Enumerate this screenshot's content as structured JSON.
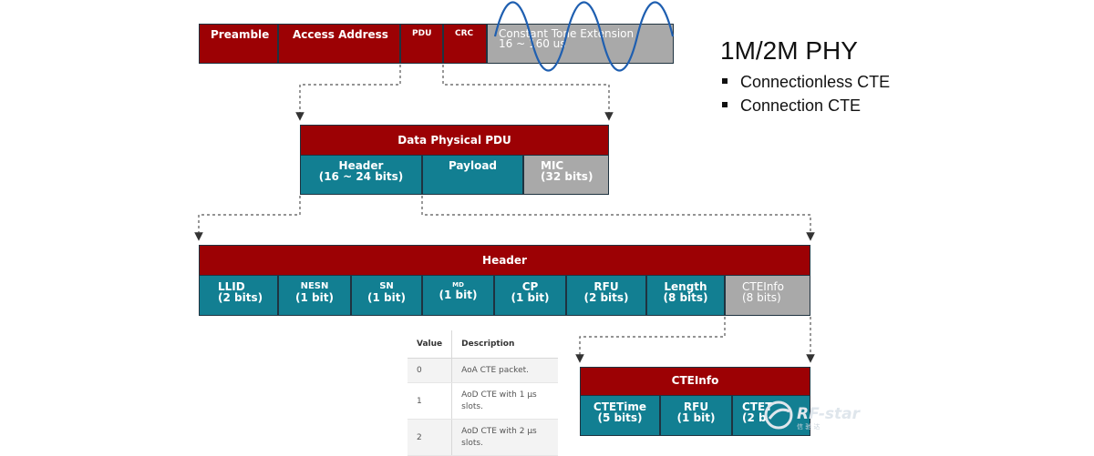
{
  "packet": {
    "fields": [
      "Preamble",
      "Access Address",
      "PDU",
      "CRC"
    ],
    "cte_title": "Constant Tone Extension",
    "cte_range": "16 ~ 160 us"
  },
  "phy": {
    "title": "1M/2M PHY",
    "bullets": [
      "Connectionless CTE",
      "Connection CTE"
    ]
  },
  "data_pdu": {
    "title": "Data Physical PDU",
    "header_line1": "Header",
    "header_line2": "(16 ~ 24 bits)",
    "payload": "Payload",
    "mic_line1": "MIC",
    "mic_line2": "(32 bits)"
  },
  "header": {
    "title": "Header",
    "cells": [
      {
        "name": "LLID",
        "bits": "(2 bits)"
      },
      {
        "name": "NESN",
        "bits": "(1 bit)"
      },
      {
        "name": "SN",
        "bits": "(1 bit)"
      },
      {
        "name": "MD",
        "bits": "(1 bit)"
      },
      {
        "name": "CP",
        "bits": "(1 bit)"
      },
      {
        "name": "RFU",
        "bits": "(2 bits)"
      },
      {
        "name": "Length",
        "bits": "(8 bits)"
      },
      {
        "name": "CTEInfo",
        "bits": "(8 bits)"
      }
    ]
  },
  "cte_table": {
    "headers": [
      "Value",
      "Description"
    ],
    "rows": [
      {
        "value": "0",
        "desc": "AoA CTE packet."
      },
      {
        "value": "1",
        "desc_line1": "AoD CTE with 1 µs",
        "desc_line2": "slots."
      },
      {
        "value": "2",
        "desc_line1": "AoD CTE with 2 µs",
        "desc_line2": "slots."
      }
    ]
  },
  "cteinfo": {
    "title": "CTEInfo",
    "cells": [
      {
        "name": "CTETime",
        "bits": "(5 bits)"
      },
      {
        "name": "RFU",
        "bits": "(1 bit)"
      },
      {
        "name": "CTET",
        "bits": "(2 b"
      }
    ]
  },
  "watermark": {
    "text": "RF-star",
    "sub": "信 驰 达"
  },
  "colors": {
    "red": "#9c0104",
    "teal": "#127f92",
    "gray": "#a9a9a9",
    "sine": "#1f5fb0"
  }
}
